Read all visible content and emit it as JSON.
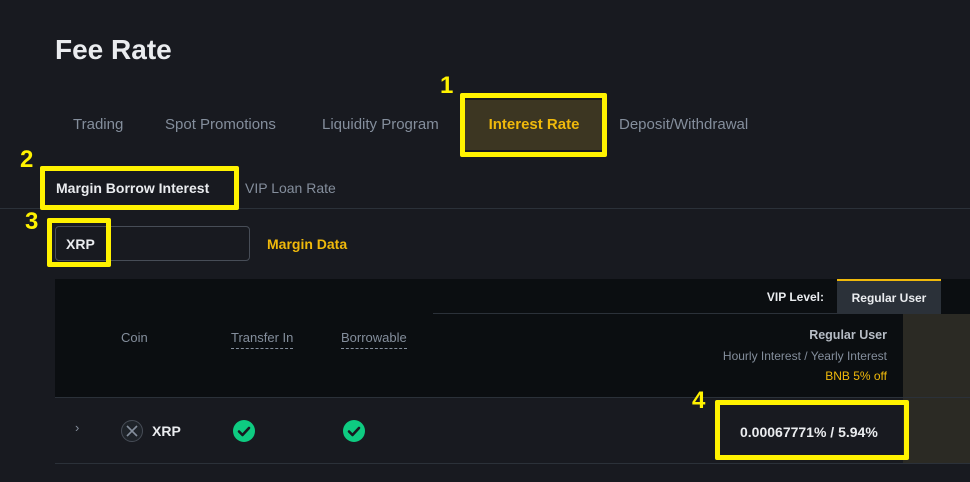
{
  "page": {
    "title": "Fee Rate"
  },
  "tabs": [
    {
      "label": "Trading"
    },
    {
      "label": "Spot Promotions"
    },
    {
      "label": "Liquidity Program"
    },
    {
      "label": "Interest Rate"
    },
    {
      "label": "Deposit/Withdrawal"
    }
  ],
  "subtabs": [
    {
      "label": "Margin Borrow Interest"
    },
    {
      "label": "VIP Loan Rate"
    }
  ],
  "search": {
    "value": "XRP"
  },
  "margin_data_link": "Margin Data",
  "table": {
    "vip_level_label": "VIP Level:",
    "vip_level_value": "Regular User",
    "columns": {
      "coin": "Coin",
      "transfer_in": "Transfer In",
      "borrowable": "Borrowable",
      "rate_title": "Regular User",
      "rate_subtitle": "Hourly Interest / Yearly Interest",
      "rate_note": "BNB 5% off"
    },
    "rows": [
      {
        "coin": "XRP",
        "transfer_in": true,
        "borrowable": true,
        "rate": "0.00067771% / 5.94%"
      }
    ]
  },
  "annotations": [
    "1",
    "2",
    "3",
    "4"
  ],
  "colors": {
    "accent": "#f0b90b",
    "highlight": "#fff200",
    "success": "#0ecb81",
    "background": "#181a20"
  }
}
